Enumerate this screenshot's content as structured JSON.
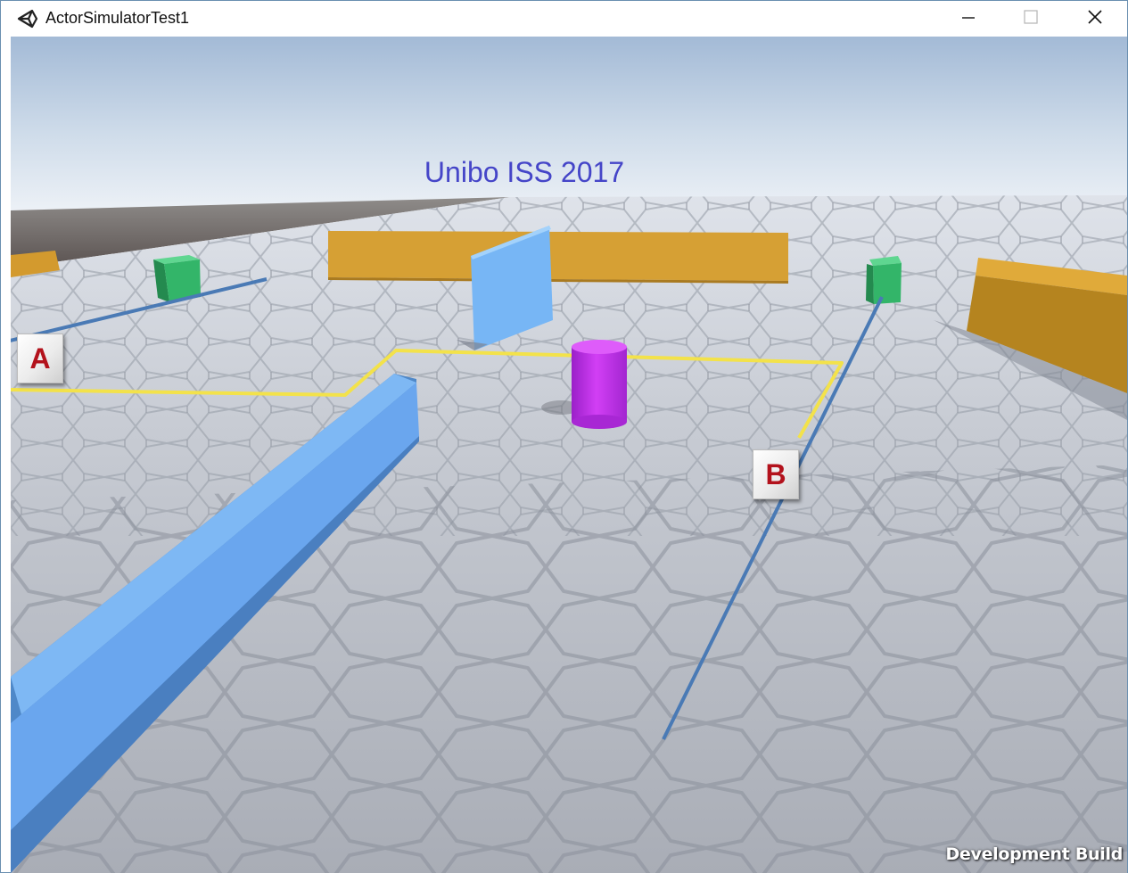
{
  "window": {
    "title": "ActorSimulatorTest1",
    "app_icon": "unity-icon",
    "controls": [
      "minimize-icon",
      "maximize-icon",
      "close-icon"
    ]
  },
  "scene": {
    "banner_text": "Unibo ISS 2017",
    "markers": [
      "A",
      "B"
    ],
    "watermark": "Development Build",
    "colors": {
      "sky_top": "#b9cde3",
      "floor": "#c9ccd3",
      "wall_orange": "#d39a2e",
      "wall_blue": "#6aaaf0",
      "box_green": "#35b86a",
      "cylinder": "#c033f0",
      "path_yellow": "#f0e04a",
      "path_blue": "#4a7ab5",
      "marker_text": "#b3121c"
    }
  }
}
